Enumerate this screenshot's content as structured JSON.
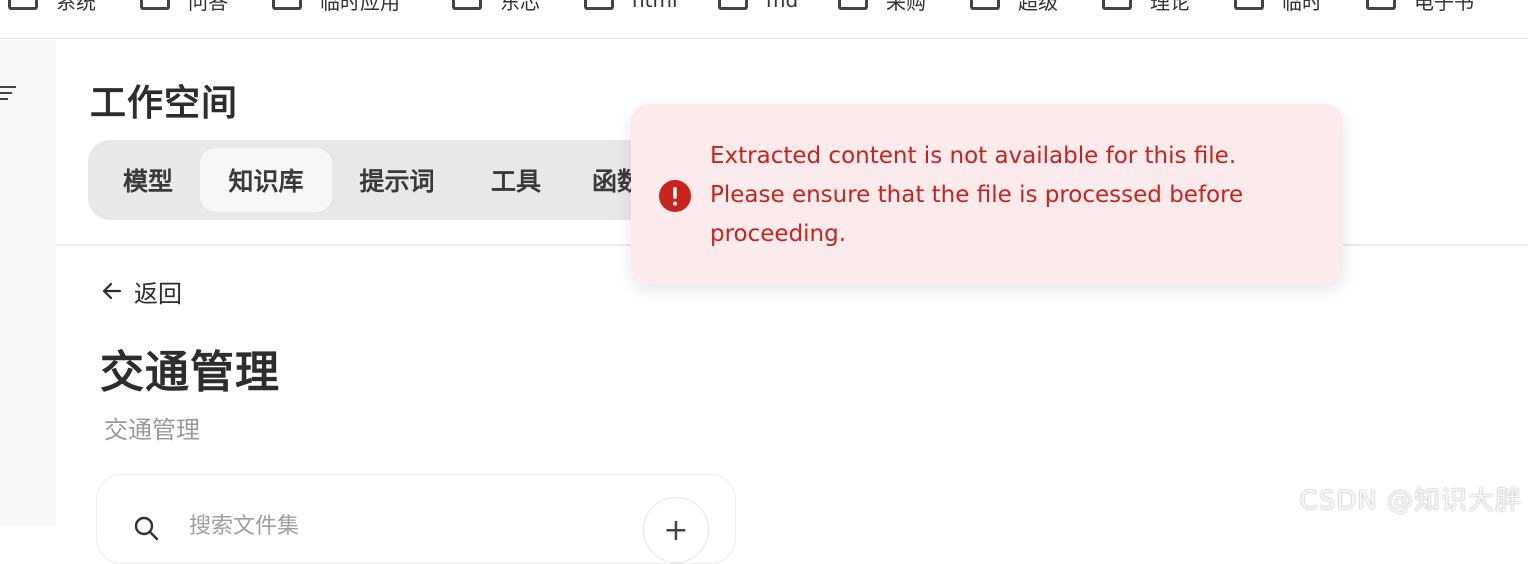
{
  "bookmarks": [
    {
      "label": "系统",
      "icon": "folder-icon"
    },
    {
      "label": "问答",
      "icon": "folder-icon"
    },
    {
      "label": "临时应用",
      "icon": "folder-icon"
    },
    {
      "label": "东芯",
      "icon": "folder-icon"
    },
    {
      "label": "html",
      "icon": "folder-icon"
    },
    {
      "label": "md",
      "icon": "folder-icon"
    },
    {
      "label": "采购",
      "icon": "folder-icon"
    },
    {
      "label": "超级",
      "icon": "folder-icon"
    },
    {
      "label": "理论",
      "icon": "folder-icon"
    },
    {
      "label": "临时",
      "icon": "folder-icon"
    },
    {
      "label": "电子书",
      "icon": "folder-icon"
    }
  ],
  "workspace": {
    "title": "工作空间",
    "tabs": [
      {
        "label": "模型",
        "active": false
      },
      {
        "label": "知识库",
        "active": true
      },
      {
        "label": "提示词",
        "active": false
      },
      {
        "label": "工具",
        "active": false
      },
      {
        "label": "函数",
        "active": false
      }
    ]
  },
  "back": {
    "label": "返回",
    "icon": "arrow-left-icon"
  },
  "knowledge": {
    "title": "交通管理",
    "description": "交通管理"
  },
  "search": {
    "placeholder": "搜索文件集",
    "icon": "search-icon",
    "add_label": "+"
  },
  "toast": {
    "icon": "error-icon",
    "message": "Extracted content is not available for this file. Please ensure that the file is processed before proceeding.",
    "color": "#c8231c",
    "background": "#fcebec"
  },
  "watermark": "CSDN @知识大胖"
}
